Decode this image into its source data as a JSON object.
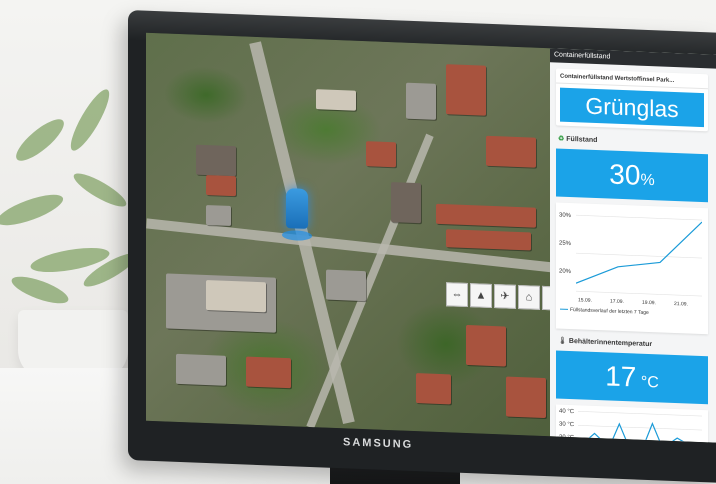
{
  "brand": "SAMSUNG",
  "panel": {
    "header": "Containerfüllstand",
    "subtitle": "Containerfüllstand Wertstoffinsel Park...",
    "glass_type": "Grünglas",
    "fill_section": "Füllstand",
    "fill_value": "30",
    "fill_unit": "%",
    "chart1": {
      "yticks": [
        "30%",
        "25%",
        "20%"
      ],
      "xticks": [
        "15.09.",
        "17.09.",
        "19.09.",
        "21.09."
      ],
      "legend": "Füllstandsverlauf der letzten 7 Tage"
    },
    "temp_section": "Behälterinnentemperatur",
    "temp_value": "17",
    "temp_unit": "°C",
    "chart2": {
      "yticks": [
        "40 °C",
        "30 °C",
        "20 °C"
      ]
    }
  },
  "chart_data": [
    {
      "type": "line",
      "x": [
        "15.09.",
        "17.09.",
        "19.09.",
        "21.09."
      ],
      "series": [
        {
          "values": [
            20,
            23,
            24,
            31
          ]
        }
      ],
      "ylim": [
        18,
        32
      ],
      "legend": "bottom"
    },
    {
      "type": "line",
      "series": [
        {
          "values": [
            18,
            20,
            25,
            20,
            19,
            32,
            19,
            20,
            19,
            33,
            20,
            20,
            24,
            21,
            19,
            20
          ]
        }
      ],
      "ylim": [
        18,
        42
      ]
    }
  ],
  "toolbar": [
    "⇔",
    "▲",
    "✈",
    "⌂",
    "▮"
  ],
  "colors": {
    "accent": "#1ba3e8",
    "line": "#1b9bd8"
  }
}
